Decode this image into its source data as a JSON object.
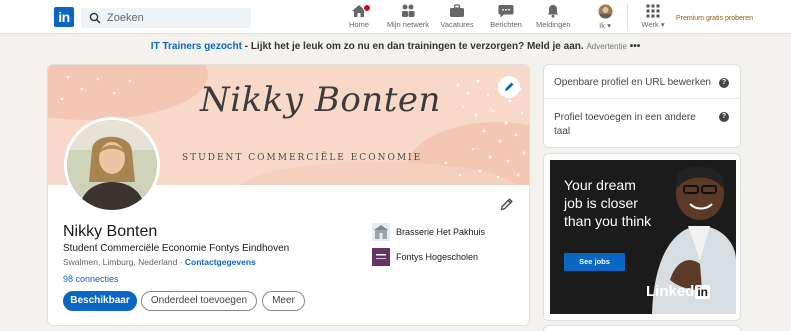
{
  "nav": {
    "logo_text": "in",
    "search_placeholder": "Zoeken",
    "items": [
      {
        "label": "Home",
        "icon": "home-icon"
      },
      {
        "label": "Mijn netwerk",
        "icon": "network-icon"
      },
      {
        "label": "Vacatures",
        "icon": "briefcase-icon"
      },
      {
        "label": "Berichten",
        "icon": "message-icon"
      },
      {
        "label": "Meldingen",
        "icon": "bell-icon"
      },
      {
        "label": "Ik ▾",
        "icon": "avatar-icon"
      },
      {
        "label": "Werk ▾",
        "icon": "grid-icon"
      }
    ],
    "premium": "Premium gratis proberen"
  },
  "ad_line": {
    "link": "IT Trainers gezocht",
    "text": " - Lijkt het je leuk om zo nu en dan trainingen te verzorgen? Meld je aan.",
    "tag": "Advertentie",
    "more": "•••"
  },
  "profile": {
    "banner_name": "Nikky Bonten",
    "banner_subtitle": "STUDENT COMMERCIËLE ECONOMIE",
    "name": "Nikky Bonten",
    "headline": "Student Commerciële Economie Fontys Eindhoven",
    "location": "Swalmen, Limburg, Nederland",
    "separator": " · ",
    "contact": "Contactgegevens",
    "connections": "98 connecties",
    "buttons": {
      "available": "Beschikbaar",
      "add_section": "Onderdeel toevoegen",
      "more": "Meer"
    },
    "organizations": [
      {
        "name": "Brasserie Het Pakhuis"
      },
      {
        "name": "Fontys Hogescholen"
      }
    ]
  },
  "sidebar": {
    "links": [
      {
        "label": "Openbare profiel en URL bewerken"
      },
      {
        "label": "Profiel toevoegen in een andere taal"
      }
    ],
    "help_icon_text": "?"
  },
  "ad_card": {
    "headline": "Your dream job is closer than you think",
    "button": "See jobs",
    "brand": "Linked",
    "brand_in": "in"
  },
  "colors": {
    "brand_blue": "#0a66c2",
    "banner_peach": "#f8d9c9",
    "notification_red": "#cc1016",
    "premium_gold": "#915907"
  }
}
